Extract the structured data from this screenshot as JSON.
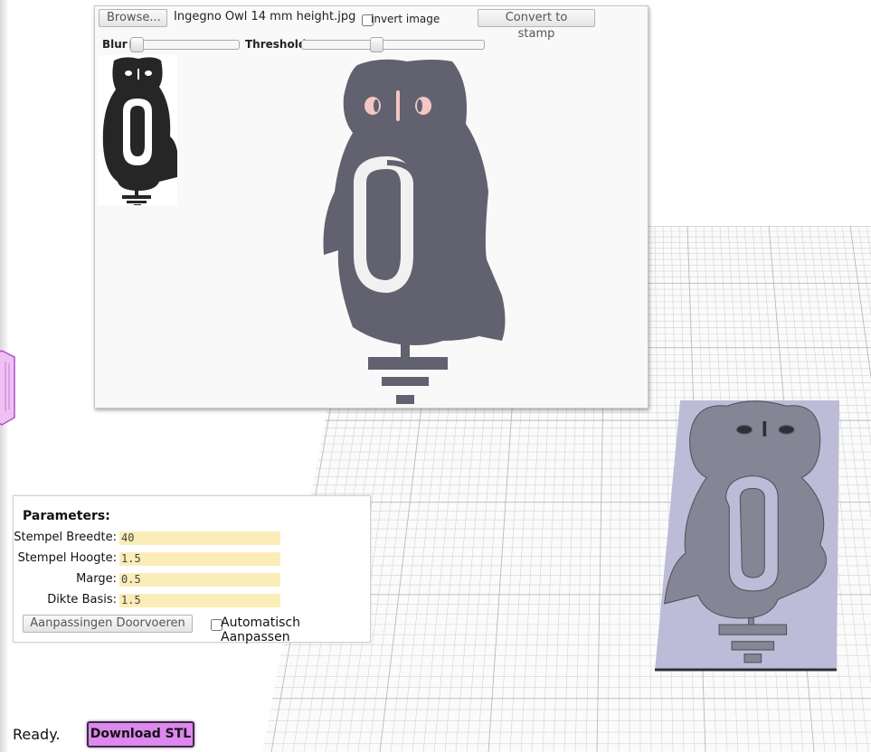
{
  "image_panel": {
    "browse_label": "Browse...",
    "file_name": "Ingegno Owl 14 mm height.jpg",
    "invert_label": "invert image",
    "convert_label": "Convert to stamp",
    "blur_label": "Blur",
    "threshold_label": "Threshold",
    "blur_value": 0.0,
    "threshold_value": 0.4
  },
  "parameters": {
    "title": "Parameters:",
    "fields": [
      {
        "label": "Stempel Breedte:",
        "value": "40"
      },
      {
        "label": "Stempel Hoogte:",
        "value": "1.5"
      },
      {
        "label": "Marge:",
        "value": "0.5"
      },
      {
        "label": "Dikte Basis:",
        "value": "1.5"
      }
    ],
    "apply_label": "Aanpassingen Doorvoeren",
    "auto_label": "Automatisch Aanpassen"
  },
  "status": "Ready.",
  "download_label": "Download STL",
  "colors": {
    "owl_preview": "#626170",
    "owl_thumb": "#262626",
    "eye_pink": "#f3c7c4",
    "stamp_base": "#bcbcd8",
    "stamp_owl": "#858595",
    "download_button": "#dd88ee",
    "input_bg": "#fbedb7"
  }
}
